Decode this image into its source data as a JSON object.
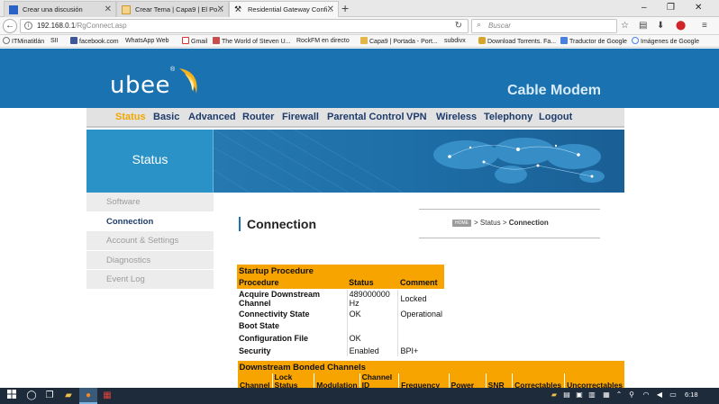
{
  "browser": {
    "tabs": [
      {
        "label": "Crear una discusión",
        "icon": "favicon-blue"
      },
      {
        "label": "Crear Tema | Capa9 | El Po...",
        "icon": "favicon-orange"
      },
      {
        "label": "Residential Gateway Confi...",
        "icon": "favicon-tools",
        "active": true
      }
    ],
    "new_tab": "+",
    "window_controls": {
      "minimize": "–",
      "restore": "❐",
      "close": "✕"
    },
    "url": {
      "host": "192.168.0.1",
      "path": "/RgConnect.asp"
    },
    "search_placeholder": "Buscar",
    "bookmarks": [
      "ITMinatitlán",
      "SII",
      "facebook.com",
      "WhatsApp Web",
      "Gmail",
      "The World of Steven U...",
      "RockFM en directo",
      "Capa9 | Portada - Port...",
      "subdivx",
      "Download Torrents. Fa...",
      "Traductor de Google",
      "Imágenes de Google"
    ]
  },
  "modem": {
    "brand": "ubee",
    "reg_mark": "®",
    "product": "Cable Modem",
    "menu": [
      "Status",
      "Basic",
      "Advanced",
      "Router",
      "Firewall",
      "Parental Control",
      "VPN",
      "Wireless",
      "Telephony",
      "Logout"
    ],
    "active_menu": "Status",
    "section_title": "Status",
    "sidebar": [
      "Software",
      "Connection",
      "Account & Settings",
      "Diagnostics",
      "Event Log"
    ],
    "active_sidebar": "Connection",
    "page_title": "Connection",
    "breadcrumb": {
      "home": "HOME",
      "parts": [
        "Status",
        "Connection"
      ],
      "sep": ">"
    },
    "startup": {
      "caption": "Startup Procedure",
      "headers": [
        "Procedure",
        "Status",
        "Comment"
      ],
      "rows": [
        [
          "Acquire Downstream Channel",
          "489000000 Hz",
          "Locked"
        ],
        [
          "Connectivity State",
          "OK",
          "Operational"
        ],
        [
          "Boot State",
          "",
          ""
        ],
        [
          "Configuration File",
          "OK",
          ""
        ],
        [
          "Security",
          "Enabled",
          "BPI+"
        ]
      ]
    },
    "downstream": {
      "caption": "Downstream Bonded Channels",
      "headers": [
        "Channel",
        "Lock Status",
        "Modulation",
        "Channel ID",
        "Frequency",
        "Power",
        "SNR",
        "Correctables",
        "Uncorrectables"
      ]
    }
  },
  "taskbar": {
    "clock": "6:18",
    "accent": "#7cb3e0"
  },
  "colors": {
    "header_blue": "#1b72b0",
    "table_orange": "#f7a400",
    "menu_active": "#f2a600",
    "menu_text": "#1d3b6b"
  }
}
